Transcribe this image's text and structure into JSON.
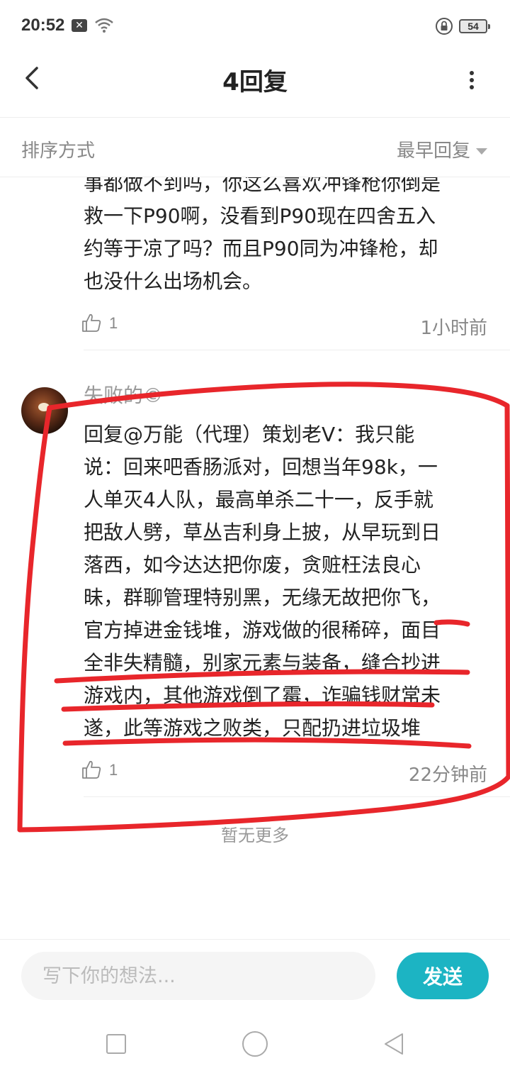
{
  "status_bar": {
    "time": "20:52",
    "notification_glyph": "✕",
    "battery": "54"
  },
  "header": {
    "title": "4回复"
  },
  "sort": {
    "label": "排序方式",
    "selected": "最早回复"
  },
  "comments": [
    {
      "lines": [
        "事都做不到吗，你这么喜欢冲锋枪你倒是",
        "救一下P90啊，没看到P90现在四舍五入",
        "约等于凉了吗？而且P90同为冲锋枪，却",
        "也没什么出场机会。"
      ],
      "likes": "1",
      "time": "1小时前"
    },
    {
      "username": "失败的©",
      "lines": [
        "回复@万能（代理）策划老V：我只能",
        "说：回来吧香肠派对，回想当年98k，一",
        "人单灭4人队，最高单杀二十一，反手就",
        "把敌人劈，草丛吉利身上披，从早玩到日",
        "落西，如今达达把你废，贪赃枉法良心",
        "昧，群聊管理特别黑，无缘无故把你飞，",
        "官方掉进金钱堆，游戏做的很稀碎，面目",
        "全非失精髓，别家元素与装备，缝合抄进",
        "游戏内，其他游戏倒了霉，诈骗钱财常未",
        "遂，此等游戏之败类，只配扔进垃圾堆"
      ],
      "likes": "1",
      "time": "22分钟前"
    }
  ],
  "footer_note": "暂无更多",
  "input": {
    "placeholder": "写下你的想法...",
    "send_label": "发送"
  },
  "colors": {
    "accent": "#1cb4c3",
    "annotation": "#e8262b"
  },
  "icons": [
    "back-arrow-icon",
    "more-vertical-icon",
    "thumbs-up-icon",
    "wifi-icon",
    "lock-rotation-icon",
    "square-nav-icon",
    "circle-nav-icon",
    "triangle-back-nav-icon"
  ]
}
